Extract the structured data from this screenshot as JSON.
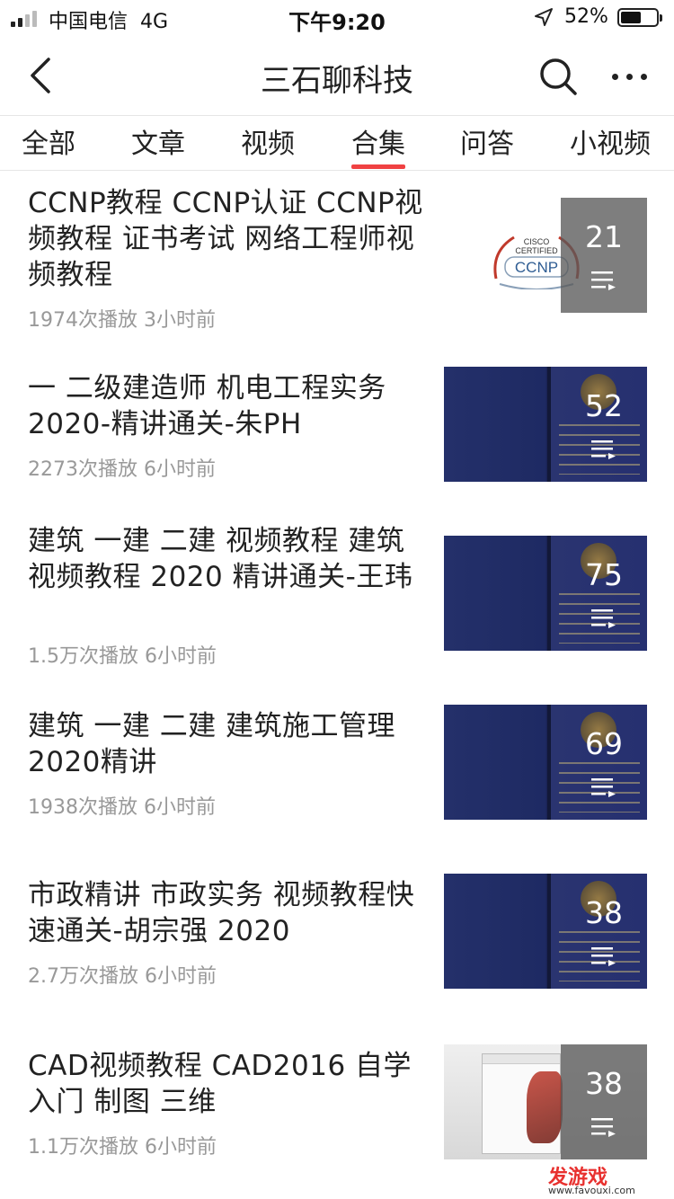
{
  "status_bar": {
    "carrier": "中国电信",
    "network": "4G",
    "time": "下午9:20",
    "battery_percent": "52%",
    "battery_level": 0.52
  },
  "header": {
    "title": "三石聊科技",
    "icons": [
      "back-arrow-icon",
      "search-icon",
      "more-icon"
    ]
  },
  "tabs": [
    {
      "label": "全部",
      "active": false
    },
    {
      "label": "文章",
      "active": false
    },
    {
      "label": "视频",
      "active": false
    },
    {
      "label": "合集",
      "active": true
    },
    {
      "label": "问答",
      "active": false
    },
    {
      "label": "小视频",
      "active": false
    }
  ],
  "accent_color": "#f04142",
  "collections": [
    {
      "title": "CCNP教程  CCNP认证 CCNP视频教程 证书考试 网络工程师视频教程",
      "meta": "1974次播放 3小时前",
      "count": "21",
      "thumb": "ccnp-logo"
    },
    {
      "title": "一 二级建造师 机电工程实务2020-精讲通关-朱PH",
      "meta": "2273次播放 6小时前",
      "count": "52",
      "thumb": "certificate"
    },
    {
      "title": "建筑 一建 二建 视频教程 建筑视频教程  2020 精讲通关-王玮",
      "meta": "1.5万次播放 6小时前",
      "count": "75",
      "thumb": "certificate"
    },
    {
      "title": "建筑 一建 二建 建筑施工管理2020精讲",
      "meta": "1938次播放 6小时前",
      "count": "69",
      "thumb": "certificate"
    },
    {
      "title": "市政精讲 市政实务  视频教程快速通关-胡宗强 2020",
      "meta": "2.7万次播放 6小时前",
      "count": "38",
      "thumb": "certificate"
    },
    {
      "title": "CAD视频教程 CAD2016  自学入门  制图  三维",
      "meta": "1.1万次播放 6小时前",
      "count": "38",
      "thumb": "cad-screenshot"
    }
  ],
  "ccnp_logo": {
    "line1": "CISCO",
    "line2": "CERTIFIED",
    "line3": "CCNP"
  },
  "watermark": {
    "main": "发游戏",
    "sub": "www.favouxi.com"
  }
}
